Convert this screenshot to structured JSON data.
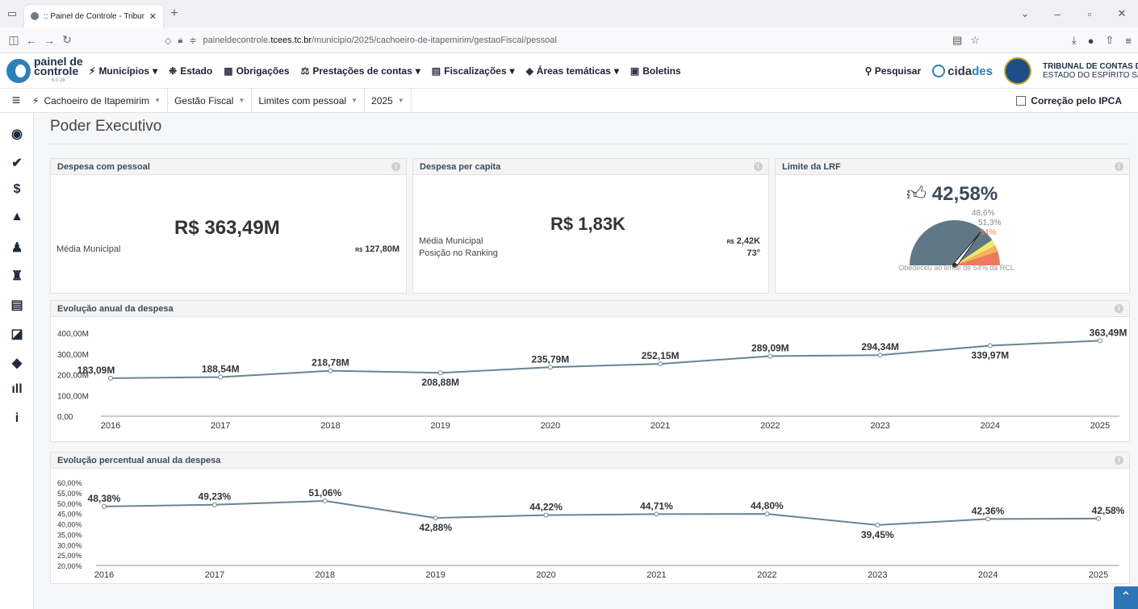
{
  "browser": {
    "tab_title": ":: Painel de Controle - Tribunal d",
    "url_prefix": "paineldecontrole.",
    "url_domain": "tcees.tc.br",
    "url_path": "/municipio/2025/cachoeiro-de-itapemirim/gestaoFiscal/pessoal"
  },
  "header": {
    "logo_line1": "painel de",
    "logo_line2": "controle",
    "logo_version": "6.0.28",
    "menu": [
      {
        "label": "Municípios",
        "icon": "wand-icon",
        "caret": "▾"
      },
      {
        "label": "Estado",
        "icon": "emblem-icon",
        "caret": ""
      },
      {
        "label": "Obrigações",
        "icon": "building-icon",
        "caret": ""
      },
      {
        "label": "Prestações de contas",
        "icon": "scale-icon",
        "caret": "▾"
      },
      {
        "label": "Fiscalizações",
        "icon": "search-doc-icon",
        "caret": "▾"
      },
      {
        "label": "Áreas temáticas",
        "icon": "cube-icon",
        "caret": "▾"
      },
      {
        "label": "Boletins",
        "icon": "newspaper-icon",
        "caret": ""
      }
    ],
    "search_label": "Pesquisar",
    "cidades_pre": "cida",
    "cidades_hl": "des",
    "tce_line1": "TRIBUNAL DE CONTAS DO",
    "tce_line2": "ESTADO DO ESPÍRITO SANTO"
  },
  "filters": {
    "municipio": "Cachoeiro de Itapemirim",
    "area": "Gestão Fiscal",
    "tema": "Limites com pessoal",
    "ano": "2025",
    "ipca_label": "Correção pelo IPCA"
  },
  "page": {
    "title": "Poder Executivo"
  },
  "cards": {
    "despesa_pessoal": {
      "title": "Despesa com pessoal",
      "value": "R$ 363,49M",
      "media_label": "Média Municipal",
      "media_cur": "R$",
      "media_value": "127,80M"
    },
    "per_capita": {
      "title": "Despesa per capita",
      "value": "R$ 1,83K",
      "media_label": "Média Municipal",
      "media_cur": "R$",
      "media_value": "2,42K",
      "ranking_label": "Posição no Ranking",
      "ranking_value": "73°"
    },
    "lrf": {
      "title": "Limite da LRF",
      "value": "42,58%",
      "level": 42.58,
      "thresholds": [
        "48,6%",
        "51,3%",
        "54%"
      ],
      "caption": "Obedeceu ao limite de 54% da RCL",
      "colors": {
        "base": "#5f7787",
        "alert": "#f0e96a",
        "prudential": "#f2b35a",
        "max": "#ee7a5c"
      }
    }
  },
  "charts": {
    "anual_title": "Evolução anual da despesa",
    "percentual_title": "Evolução percentual anual da despesa"
  },
  "chart_data": [
    {
      "type": "line",
      "title": "Evolução anual da despesa",
      "x": [
        "2016",
        "2017",
        "2018",
        "2019",
        "2020",
        "2021",
        "2022",
        "2023",
        "2024",
        "2025"
      ],
      "values": [
        183.09,
        188.54,
        218.78,
        208.88,
        235.79,
        252.15,
        289.09,
        294.34,
        339.97,
        363.49
      ],
      "labels": [
        "183,09M",
        "188,54M",
        "218,78M",
        "208,88M",
        "235,79M",
        "252,15M",
        "289,09M",
        "294,34M",
        "339,97M",
        "363,49M"
      ],
      "yticks": [
        "0,00",
        "100,00M",
        "200,00M",
        "300,00M",
        "400,00M"
      ],
      "ylim": [
        0,
        400
      ],
      "line_color": "#6b8393"
    },
    {
      "type": "line",
      "title": "Evolução percentual anual da despesa",
      "x": [
        "2016",
        "2017",
        "2018",
        "2019",
        "2020",
        "2021",
        "2022",
        "2023",
        "2024",
        "2025"
      ],
      "values": [
        48.38,
        49.23,
        51.06,
        42.88,
        44.22,
        44.71,
        44.8,
        39.45,
        42.36,
        42.58
      ],
      "labels": [
        "48,38%",
        "49,23%",
        "51,06%",
        "42,88%",
        "44,22%",
        "44,71%",
        "44,80%",
        "39,45%",
        "42,36%",
        "42,58%"
      ],
      "yticks": [
        "20,00%",
        "25,00%",
        "30,00%",
        "35,00%",
        "40,00%",
        "45,00%",
        "50,00%",
        "55,00%",
        "60,00%"
      ],
      "ylim": [
        20,
        60
      ],
      "line_color": "#6b8393"
    }
  ]
}
